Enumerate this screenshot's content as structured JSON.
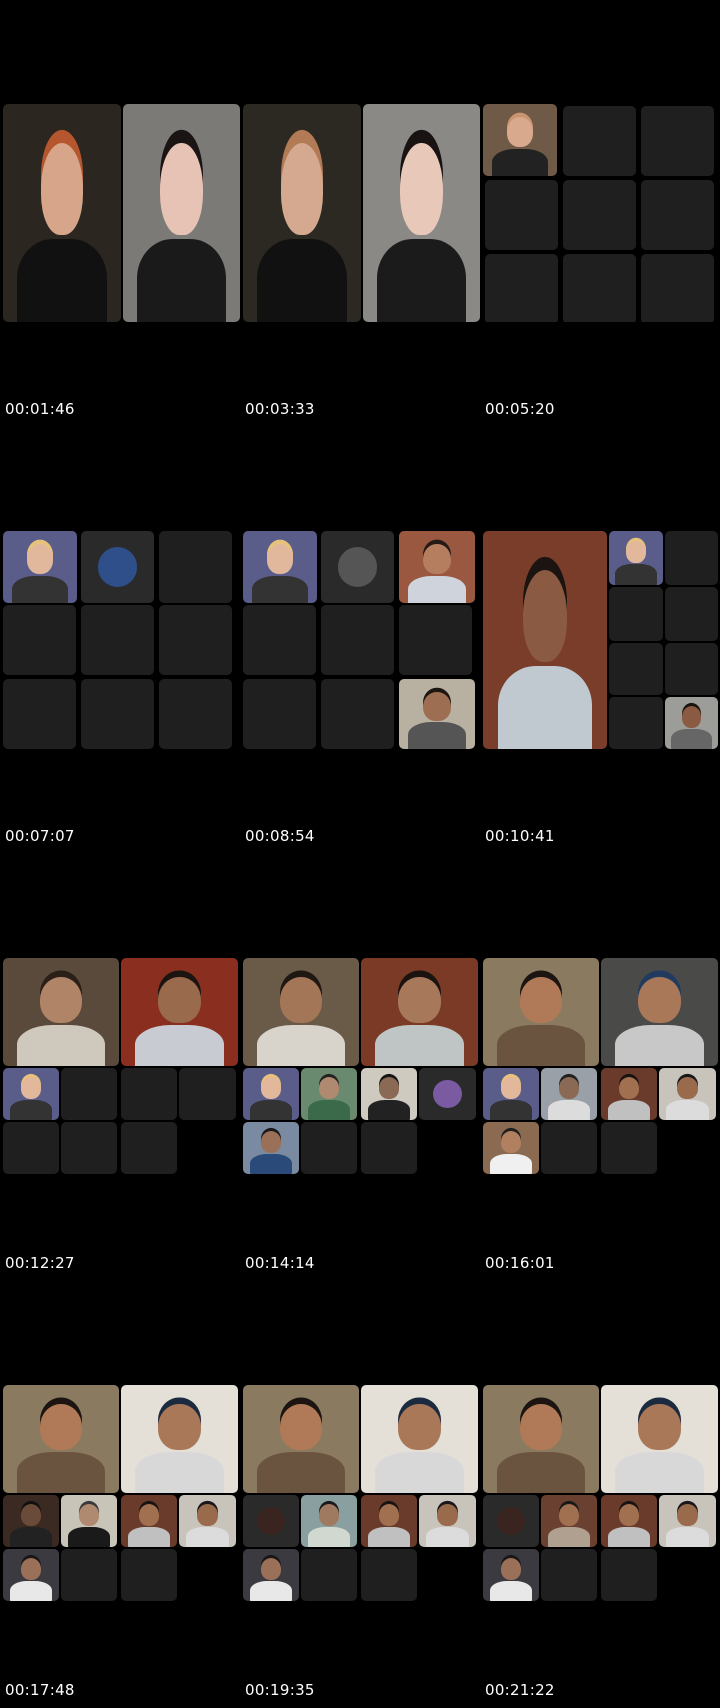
{
  "sheet": {
    "timestamps": [
      "00:01:46",
      "00:03:33",
      "00:05:20",
      "00:07:07",
      "00:08:54",
      "00:10:41",
      "00:12:27",
      "00:14:14",
      "00:16:01",
      "00:17:48",
      "00:19:35",
      "00:21:22"
    ]
  },
  "colors": {
    "background": "#000000",
    "empty_tile": "#1f1f1f",
    "timestamp_text": "#ffffff"
  }
}
